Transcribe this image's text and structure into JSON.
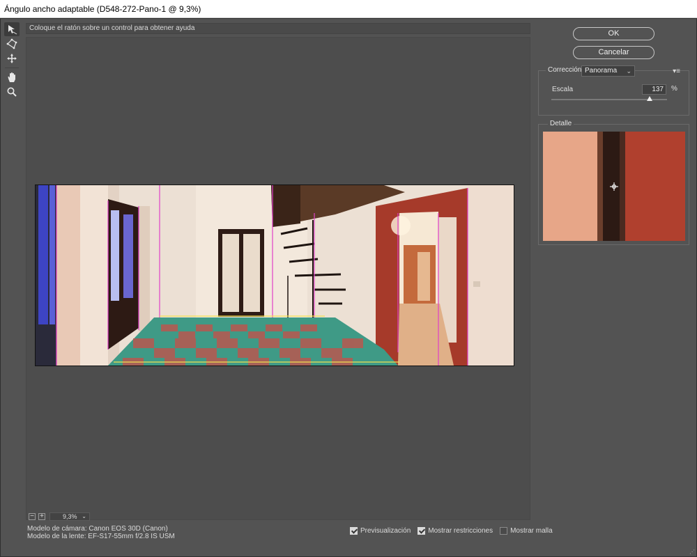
{
  "window": {
    "title": "Ángulo ancho adaptable (D548-272-Pano-1 @ 9,3%)"
  },
  "toolbar": {
    "tools": [
      {
        "icon": "constraint-arrow-icon",
        "active": true
      },
      {
        "icon": "polygon-constraint-icon",
        "active": false
      },
      {
        "icon": "move-icon",
        "active": false
      },
      {
        "icon": "hand-icon",
        "active": false
      },
      {
        "icon": "zoom-icon",
        "active": false
      }
    ]
  },
  "help": {
    "text": "Coloque el ratón sobre un control para obtener ayuda"
  },
  "zoom": {
    "minus": "−",
    "plus": "+",
    "value": "9,3%"
  },
  "info": {
    "camera": "Modelo de cámara: Canon EOS 30D (Canon)",
    "lens": "Modelo de la lente: EF-S17-55mm f/2.8 IS USM"
  },
  "options": {
    "preview": {
      "label": "Previsualización",
      "checked": true
    },
    "constraints": {
      "label": "Mostrar restricciones",
      "checked": true
    },
    "mesh": {
      "label": "Mostrar malla",
      "checked": false
    }
  },
  "buttons": {
    "ok": "OK",
    "cancel": "Cancelar"
  },
  "correction": {
    "label": "Corrección:",
    "value": "Panorama",
    "scale_label": "Escala",
    "scale_value": "137",
    "unit": "%",
    "scale_fraction": 0.85
  },
  "detail": {
    "label": "Detalle"
  },
  "colors": {
    "panel_bg": "#535353",
    "constraint_magenta": "#e040c8",
    "constraint_yellow": "#f0e050",
    "wall": "#efe0d2",
    "door_red": "#a83a28",
    "tile_green": "#3f9a86",
    "tile_red": "#b8584f"
  }
}
